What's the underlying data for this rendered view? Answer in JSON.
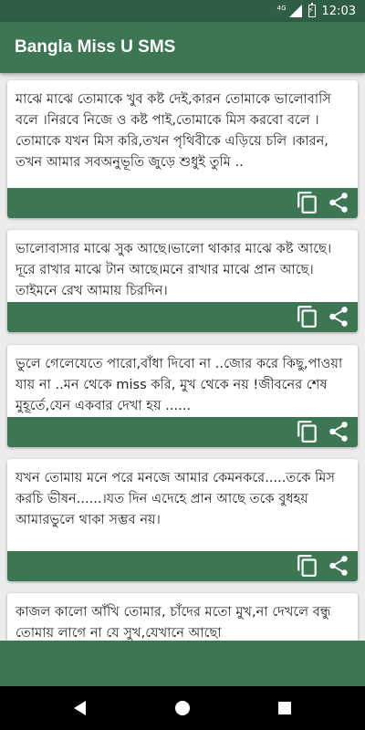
{
  "status_bar": {
    "time": "12:03",
    "network_label": "4G",
    "icons": [
      "signal-icon",
      "battery-charging-icon"
    ]
  },
  "app": {
    "title": "Bangla Miss U SMS",
    "colors": {
      "primary": "#3d7653",
      "status_bar": "#2f5e44"
    }
  },
  "messages": [
    {
      "text": "মাঝে মাঝে তোমাকে খুব কষ্ট দেই,কারন তোমাকে ভালোবাসি বলে ।নিরবে নিজে ও কষ্ট পাই,তোমাকে মিস করবো বলে ।তোমাকে যখন মিস করি,তখন পৃথিবীকে এড়িয়ে চলি ।কারন, তখন আমার সবঅনুভূতি জুড়ে শুধুই তুমি .."
    },
    {
      "text": "ভালোবাসার মাঝে সুক আছে।ভালো থাকার মাঝে কষ্ট আছে।দূরে রাখার মাঝে টান আছে।মনে রাখার মাঝে প্রান আছে। তাইমনে রেখ আমায় চিরদিন।"
    },
    {
      "text": "ভুলে গেলেযেতে পারো,বাঁধা দিবো না ..জোর করে কিছু,পাওয়া যায় না ..মন থেকে miss করি, মুখ থেকে নয় !জীবনের শেষ মুহূর্তে,যেন একবার দেখা হয় ......"
    },
    {
      "text": "যখন তোমায় মনে পরে মনজে আমার কেমনকরে.....তকে মিস করচি ভীষন......।যত দিন এদেহে প্রান আছে তকে বুধহয় আমারভুলে থাকা সম্ভব নয়।"
    },
    {
      "text": "কাজল কালো আঁখি তোমার, চাঁদের মতো মুখ,না দেখলে বন্ধু তোমায় লাগে না যে সুখ,যেখানে আছো"
    }
  ],
  "actions": {
    "copy_icon": "copy-icon",
    "share_icon": "share-icon"
  },
  "nav": {
    "icons": [
      "back-icon",
      "home-icon",
      "recents-icon"
    ]
  }
}
